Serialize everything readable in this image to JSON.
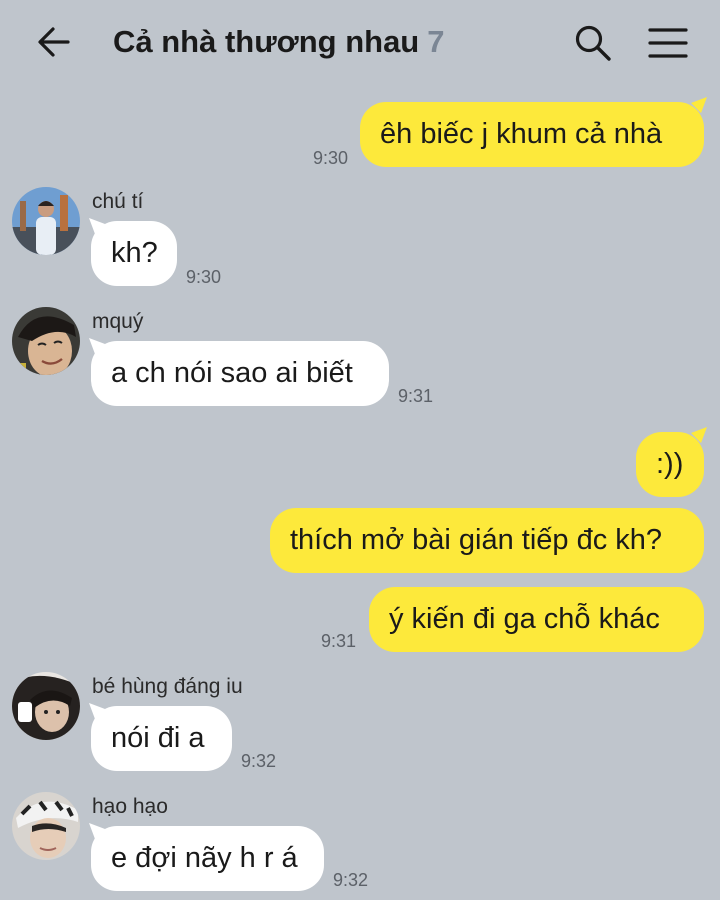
{
  "header": {
    "title": "Cả nhà thương nhau",
    "member_count": "7",
    "back_icon": "arrow-left-icon",
    "search_icon": "search-icon",
    "menu_icon": "hamburger-menu-icon"
  },
  "messages": [
    {
      "from": "me",
      "text": "êh biếc j khum cả nhà",
      "time": "9:30"
    },
    {
      "from": "chú tí",
      "text": "kh?",
      "time": "9:30"
    },
    {
      "from": "mquý",
      "text": "a ch nói sao ai biết",
      "time": "9:31"
    },
    {
      "from": "me",
      "text": ":))",
      "time": ""
    },
    {
      "from": "me",
      "text": "thích mở bài gián tiếp đc kh?",
      "time": ""
    },
    {
      "from": "me",
      "text": "ý kiến đi ga chỗ khác",
      "time": "9:31"
    },
    {
      "from": "bé hùng đáng iu",
      "text": "nói đi a",
      "time": "9:32"
    },
    {
      "from": "hạo hạo",
      "text": "e đợi nãy h r á",
      "time": "9:32"
    }
  ],
  "colors": {
    "background": "#bfc5cc",
    "outgoing_bubble": "#fde93b",
    "incoming_bubble": "#ffffff",
    "member_count": "#7b8694"
  }
}
